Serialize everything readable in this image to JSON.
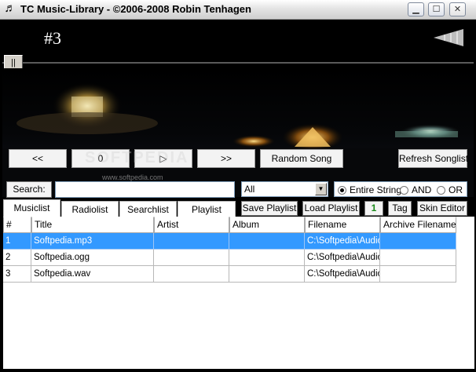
{
  "window": {
    "title": "TC Music-Library - ©2006-2008 Robin Tenhagen",
    "icon": "music-note-icon",
    "controls": [
      "minimize-icon",
      "maximize-icon",
      "close-icon"
    ]
  },
  "player": {
    "track_number": "#3",
    "seek_label": "||",
    "watermark": "SOFTPEDIA",
    "watermark_url": "www.softpedia.com"
  },
  "transport": {
    "prev_label": "<<",
    "stop_label": "0",
    "play_label": "▷",
    "next_label": ">>",
    "random_label": "Random Song",
    "refresh_label": "Refresh Songlist"
  },
  "search": {
    "button_label": "Search:",
    "value": "",
    "filter_selected": "All",
    "modes": [
      {
        "label": "Entire String",
        "selected": true
      },
      {
        "label": "AND",
        "selected": false
      },
      {
        "label": "OR",
        "selected": false
      }
    ]
  },
  "tabs": [
    {
      "label": "Musiclist",
      "active": true
    },
    {
      "label": "Radiolist",
      "active": false
    },
    {
      "label": "Searchlist",
      "active": false
    },
    {
      "label": "Playlist",
      "active": false
    }
  ],
  "toolbar": {
    "save_playlist": "Save Playlist",
    "load_playlist": "Load Playlist",
    "number_badge": "1",
    "tag": "Tag",
    "skin_editor": "Skin Editor"
  },
  "table": {
    "columns": [
      "#",
      "Title",
      "Artist",
      "Album",
      "Filename",
      "Archive Filename"
    ],
    "rows": [
      {
        "num": "1",
        "title": "Softpedia.mp3",
        "artist": "",
        "album": "",
        "filename": "C:\\Softpedia\\Audio",
        "archive": "",
        "selected": true
      },
      {
        "num": "2",
        "title": "Softpedia.ogg",
        "artist": "",
        "album": "",
        "filename": "C:\\Softpedia\\Audio",
        "archive": "",
        "selected": false
      },
      {
        "num": "3",
        "title": "Softpedia.wav",
        "artist": "",
        "album": "",
        "filename": "C:\\Softpedia\\Audio",
        "archive": "",
        "selected": false
      }
    ]
  },
  "colors": {
    "selection": "#3399ff",
    "badge_green": "#1a8a1a"
  }
}
